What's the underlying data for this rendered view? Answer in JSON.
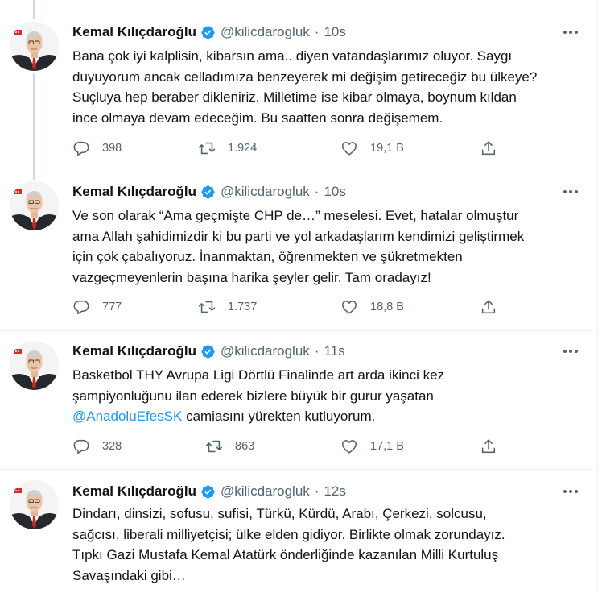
{
  "author": {
    "name": "Kemal Kılıçdaroğlu",
    "handle": "@kilicdarogluk"
  },
  "tweets": [
    {
      "time": "10s",
      "lines": [
        "Bana çok iyi kalplisin, kibarsın ama.. diyen vatandaşlarımız oluyor. Saygı",
        "duyuyorum ancak celladımıza benzeyerek mi değişim getireceğiz bu ülkeye?",
        "Suçluya hep beraber dikleniriz. Milletime ise kibar olmaya, boynum kıldan",
        "ince olmaya devam edeceğim. Bu saatten sonra değişemem."
      ],
      "replies": "398",
      "retweets": "1.924",
      "likes": "19,1 B"
    },
    {
      "time": "10s",
      "lines": [
        "Ve son olarak “Ama geçmişte CHP de…” meselesi. Evet, hatalar olmuştur",
        "ama Allah şahidimizdir ki bu parti ve yol arkadaşlarım kendimizi geliştirmek",
        "için çok çabalıyoruz. İnanmaktan, öğrenmekten ve şükretmekten",
        "vazgeçmeyenlerin başına harika şeyler gelir. Tam oradayız!"
      ],
      "replies": "777",
      "retweets": "1.737",
      "likes": "18,8 B"
    },
    {
      "time": "11s",
      "lines": [
        "Basketbol THY Avrupa Ligi Dörtlü Finalinde art arda ikinci kez",
        "şampiyonluğunu ilan ederek bizlere büyük bir gurur yaşatan"
      ],
      "mention": "@AnadoluEfesSK",
      "mention_rest": " camiasını yürekten kutluyorum.",
      "replies": "328",
      "retweets": "863",
      "likes": "17,1 B"
    },
    {
      "time": "12s",
      "lines": [
        "Dindarı, dinsizi, sofusu, sufisi, Türkü, Kürdü, Arabı, Çerkezi, solcusu,",
        "sağcısı, liberali milliyetçisi; ülke elden gidiyor. Birlikte olmak zorundayız.",
        "Tıpkı Gazi Mustafa Kemal Atatürk önderliğinde kazanılan Milli Kurtuluş",
        "Savaşındaki gibi…"
      ]
    }
  ],
  "colors": {
    "text": "#0f1419",
    "muted": "#536471",
    "accent": "#1d9bf0",
    "verified": "#1d9bf0",
    "border": "#eff3f4",
    "thread_line": "#cfd9de"
  },
  "icons": {
    "verified": "verified-badge-icon",
    "more": "more-dots-icon",
    "reply": "reply-bubble-icon",
    "retweet": "retweet-icon",
    "like": "heart-icon",
    "share": "share-upload-icon"
  }
}
